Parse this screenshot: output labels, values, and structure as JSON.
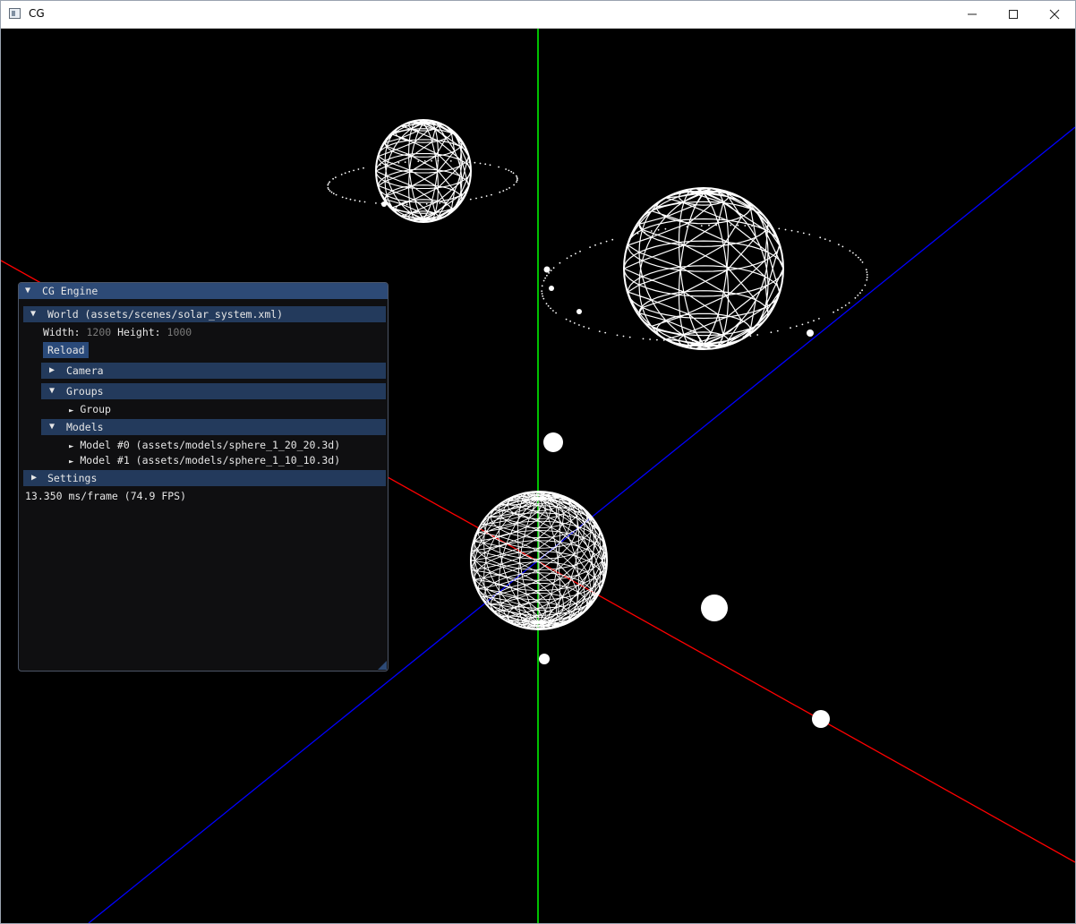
{
  "window": {
    "title": "CG"
  },
  "panel": {
    "title": "CG Engine",
    "world": {
      "label": "World (assets/scenes/solar_system.xml)",
      "width_label": "Width:",
      "width_value": "1200",
      "height_label": "Height:",
      "height_value": "1000",
      "reload_label": "Reload"
    },
    "camera": {
      "label": "Camera"
    },
    "groups": {
      "label": "Groups",
      "items": [
        "Group"
      ]
    },
    "models": {
      "label": "Models",
      "items": [
        "Model #0 (assets/models/sphere_1_20_20.3d)",
        "Model #1 (assets/models/sphere_1_10_10.3d)"
      ]
    },
    "settings": {
      "label": "Settings"
    },
    "status": "13.350 ms/frame (74.9 FPS)"
  },
  "icons": {
    "expanded": "▼",
    "collapsed": "▶",
    "leaf": "►",
    "app": "app-icon",
    "minimize": "minimize-icon",
    "maximize": "maximize-icon",
    "close": "close-icon"
  },
  "colors": {
    "x_axis": "#ff0000",
    "y_axis": "#00c000",
    "z_axis": "#0000ff",
    "panel_title": "#2d4a76",
    "panel_header": "#233a5c"
  }
}
